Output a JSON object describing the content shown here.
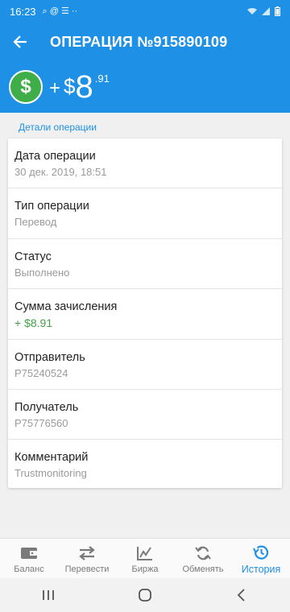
{
  "status_bar": {
    "time": "16:23",
    "left_symbols": "⌕ @ ☰ ··"
  },
  "app_bar": {
    "title": "ОПЕРАЦИЯ №915890109"
  },
  "amount": {
    "sign": "+",
    "currency": "$",
    "whole": "8",
    "fraction": ".91",
    "coin_symbol": "$"
  },
  "section": {
    "label": "Детали операции"
  },
  "details": [
    {
      "label": "Дата операции",
      "value": "30 дек. 2019, 18:51"
    },
    {
      "label": "Тип операции",
      "value": "Перевод"
    },
    {
      "label": "Статус",
      "value": "Выполнено"
    },
    {
      "label": "Сумма зачисления",
      "value": "+ $8.91"
    },
    {
      "label": "Отправитель",
      "value": "P75240524"
    },
    {
      "label": "Получатель",
      "value": "P75776560"
    },
    {
      "label": "Комментарий",
      "value": "Trustmonitoring"
    }
  ],
  "bottom_nav": {
    "items": [
      {
        "label": "Баланс",
        "icon": "wallet-icon"
      },
      {
        "label": "Перевести",
        "icon": "transfer-arrows-icon"
      },
      {
        "label": "Биржа",
        "icon": "chart-icon"
      },
      {
        "label": "Обменять",
        "icon": "exchange-refresh-icon"
      },
      {
        "label": "История",
        "icon": "history-icon"
      }
    ],
    "active_index": 4
  },
  "colors": {
    "primary": "#1e90e6",
    "green": "#43a047",
    "coin": "#3fae49"
  }
}
